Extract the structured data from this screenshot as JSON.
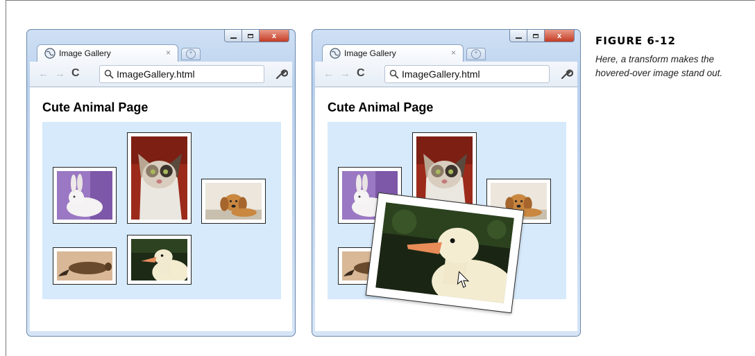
{
  "browser": {
    "tab_title": "Image Gallery",
    "tab_close": "×",
    "newtab": "+",
    "address": "ImageGallery.html",
    "back_icon": "←",
    "forward_icon": "→",
    "reload_icon": "C",
    "close_glyph": "x"
  },
  "page": {
    "title": "Cute Animal Page",
    "images": [
      {
        "name": "rabbit"
      },
      {
        "name": "kitten"
      },
      {
        "name": "puppy"
      },
      {
        "name": "platypus"
      },
      {
        "name": "gosling"
      }
    ],
    "hovered_image": "gosling"
  },
  "caption": {
    "label": "FIGURE 6-12",
    "text": "Here, a transform makes the hovered-over image stand out."
  },
  "colors": {
    "gallery_bg": "#d6eafc",
    "window_frame": "#b9d1ee",
    "close_button": "#c43c24"
  }
}
